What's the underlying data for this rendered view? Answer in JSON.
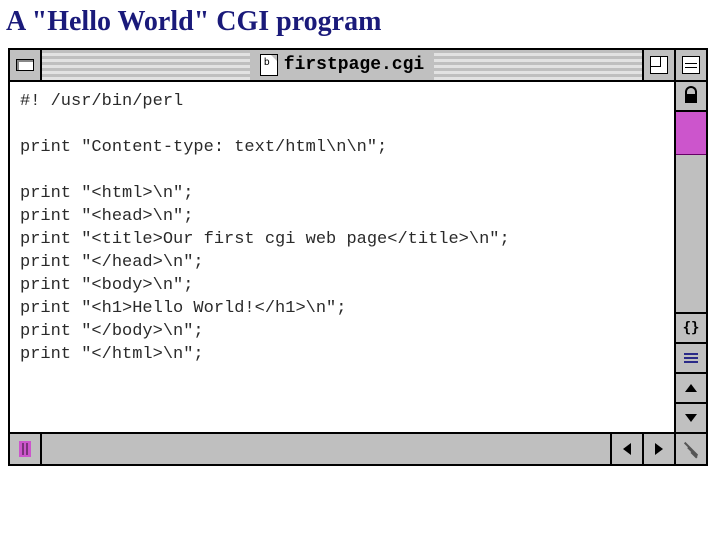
{
  "page": {
    "title": "A \"Hello World\" CGI program"
  },
  "window": {
    "filename": "firstpage.cgi"
  },
  "code": {
    "lines": [
      "#! /usr/bin/perl",
      "",
      "print \"Content-type: text/html\\n\\n\";",
      "",
      "print \"<html>\\n\";",
      "print \"<head>\\n\";",
      "print \"<title>Our first cgi web page</title>\\n\";",
      "print \"</head>\\n\";",
      "print \"<body>\\n\";",
      "print \"<h1>Hello World!</h1>\\n\";",
      "print \"</body>\\n\";",
      "print \"</html>\\n\";"
    ]
  },
  "icons": {
    "close": "close-box-icon",
    "document": "document-icon",
    "zoom": "zoom-box-icon",
    "collapse": "collapse-box-icon",
    "lock": "lock-icon",
    "popup": "popup-nav-icon",
    "lineview": "line-view-icon",
    "scroll_up": "scroll-up-arrow-icon",
    "scroll_down": "scroll-down-arrow-icon",
    "scroll_left": "scroll-left-arrow-icon",
    "scroll_right": "scroll-right-arrow-icon",
    "columns": "column-marker-icon",
    "resize": "resize-grip-icon"
  },
  "colors": {
    "title_text": "#1a1a7a",
    "chrome": "#c0c0c0",
    "accent": "#cc55cc"
  }
}
